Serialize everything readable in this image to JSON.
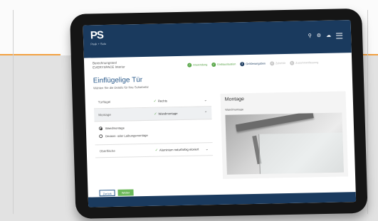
{
  "header": {
    "logo_mark": "PS",
    "logo_text": "Peak + Solo",
    "icons": [
      "search-icon",
      "settings-icon",
      "cloud-icon",
      "menu-icon"
    ]
  },
  "breadcrumb": {
    "line1": "Berechnungstool",
    "line2": "EVERYSPACE Interior"
  },
  "steps": [
    {
      "label": "Anwendung",
      "state": "done"
    },
    {
      "label": "Einbausituation",
      "state": "done"
    },
    {
      "label": "Größenangaben",
      "state": "active",
      "number": "3"
    },
    {
      "label": "Zubehör",
      "state": "todo",
      "number": "4"
    },
    {
      "label": "Zusammenfassung",
      "state": "todo",
      "number": "5"
    }
  ],
  "page": {
    "title": "Einflügelige Tür",
    "subtitle": "Wählen Sie die Details für Ihre Schiebetür"
  },
  "config": {
    "tuerfluegel": {
      "label": "Türflügel",
      "value": "Rechts"
    },
    "montage": {
      "label": "Montage",
      "value": "Wandmontage"
    },
    "montage_options": [
      "Wandmontage",
      "Decken- oder Laibungsmontage"
    ],
    "oberflaeche": {
      "label": "Oberfläche",
      "value": "Aluminium naturfarbig eloxiert"
    }
  },
  "preview": {
    "title": "Montage",
    "subtitle": "Wandmontage"
  },
  "buttons": {
    "back": "Zurück",
    "next": "Weiter"
  },
  "colors": {
    "brand": "#1a3a5e",
    "accent_green": "#5aa84a",
    "title_blue": "#2b5b8c"
  }
}
